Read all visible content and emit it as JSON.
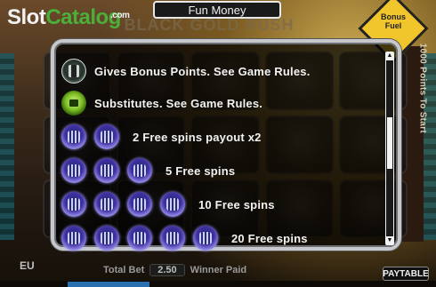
{
  "logo": {
    "slot": "Slot",
    "catalog": "Catalog",
    "dotcom": ".com"
  },
  "header": {
    "fun_money": "Fun Money"
  },
  "background": {
    "title": "BLACK GOLD RUSH",
    "warning_sign": "Bonus Fuel",
    "vertical_text": "1000 Points To Start"
  },
  "paytable": {
    "rows": [
      {
        "symbol": "bonus-icon",
        "count": 1,
        "text": "Gives Bonus Points. See Game Rules."
      },
      {
        "symbol": "wild-icon",
        "count": 1,
        "text": "Substitutes. See Game Rules."
      },
      {
        "symbol": "scatter-icon",
        "count": 2,
        "text": "2 Free spins payout x2"
      },
      {
        "symbol": "scatter-icon",
        "count": 3,
        "text": "5 Free spins"
      },
      {
        "symbol": "scatter-icon",
        "count": 4,
        "text": "10 Free spins"
      },
      {
        "symbol": "scatter-icon",
        "count": 5,
        "text": "20 Free spins"
      }
    ]
  },
  "bottom": {
    "eu": "EU",
    "total_bet_label": "Total Bet",
    "total_bet_value": "2.50",
    "winner_paid_label": "Winner Paid",
    "paytable_button": "PAYTABLE"
  },
  "colors": {
    "logo_green": "#4caf3a",
    "panel_border": "#c6c8cc",
    "scatter_blue": "#4030a0",
    "wild_green": "#7cbf22"
  }
}
